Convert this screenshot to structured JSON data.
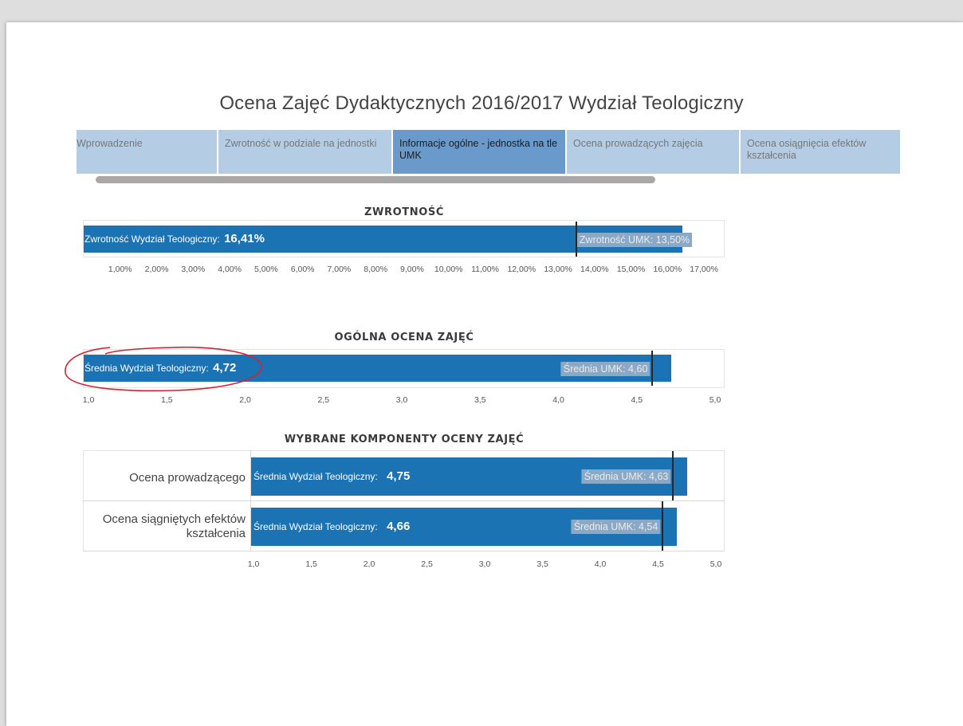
{
  "page": {
    "title": "Ocena Zajęć Dydaktycznych 2016/2017 Wydział Teologiczny"
  },
  "tabs": [
    {
      "label": "Wprowadzenie",
      "active": false
    },
    {
      "label": "Zwrotność w podziale na jednostki",
      "active": false
    },
    {
      "label": "Informacje ogólne - jednostka na tle UMK",
      "active": true
    },
    {
      "label": "Ocena prowadzących zajęcia",
      "active": false
    },
    {
      "label": "Ocena osiągnięcia efektów kształcenia",
      "active": false
    }
  ],
  "colors": {
    "bar": "#1c73b4",
    "tab": "#b4cde4",
    "tab_active": "#6a9acb",
    "annotation": "#d9202f"
  },
  "chart_data": [
    {
      "type": "bar",
      "orientation": "horizontal",
      "title": "ZWROTNOŚĆ",
      "xlim": [
        0,
        17.5
      ],
      "ticks": [
        1,
        2,
        3,
        4,
        5,
        6,
        7,
        8,
        9,
        10,
        11,
        12,
        13,
        14,
        15,
        16,
        17
      ],
      "tick_labels": [
        "1,00%",
        "2,00%",
        "3,00%",
        "4,00%",
        "5,00%",
        "6,00%",
        "7,00%",
        "8,00%",
        "9,00%",
        "10,00%",
        "11,00%",
        "12,00%",
        "13,00%",
        "14,00%",
        "15,00%",
        "16,00%",
        "17,00%"
      ],
      "value": 16.41,
      "label_prefix": "Zwrotność Wydział Teologiczny:",
      "value_label": "16,41%",
      "reference": {
        "value": 13.5,
        "label": "Zwrotność UMK: 13,50%"
      }
    },
    {
      "type": "bar",
      "orientation": "horizontal",
      "title": "OGÓLNA OCENA ZAJĘĆ",
      "xlim": [
        1.0,
        5.0
      ],
      "ticks": [
        1.0,
        1.5,
        2.0,
        2.5,
        3.0,
        3.5,
        4.0,
        4.5,
        5.0
      ],
      "tick_labels": [
        "1,0",
        "1,5",
        "2,0",
        "2,5",
        "3,0",
        "3,5",
        "4,0",
        "4,5",
        "5,0"
      ],
      "value": 4.72,
      "label_prefix": "Średnia Wydział Teologiczny:",
      "value_label": "4,72",
      "reference": {
        "value": 4.6,
        "label": "Średnia UMK: 4,60"
      }
    },
    {
      "type": "bar",
      "orientation": "horizontal",
      "title": "WYBRANE KOMPONENTY OCENY ZAJĘĆ",
      "xlim": [
        1.0,
        5.0
      ],
      "ticks": [
        1.0,
        1.5,
        2.0,
        2.5,
        3.0,
        3.5,
        4.0,
        4.5,
        5.0
      ],
      "tick_labels": [
        "1,0",
        "1,5",
        "2,0",
        "2,5",
        "3,0",
        "3,5",
        "4,0",
        "4,5",
        "5,0"
      ],
      "categories": [
        "Ocena prowadzącego",
        "Ocena siągniętych efektów kształcenia"
      ],
      "values": [
        4.75,
        4.66
      ],
      "label_prefix": "Średnia Wydział Teologiczny:",
      "value_labels": [
        "4,75",
        "4,66"
      ],
      "reference": {
        "values": [
          4.63,
          4.54
        ],
        "labels": [
          "Średnia UMK: 4,63",
          "Średnia UMK: 4,54"
        ]
      }
    }
  ]
}
